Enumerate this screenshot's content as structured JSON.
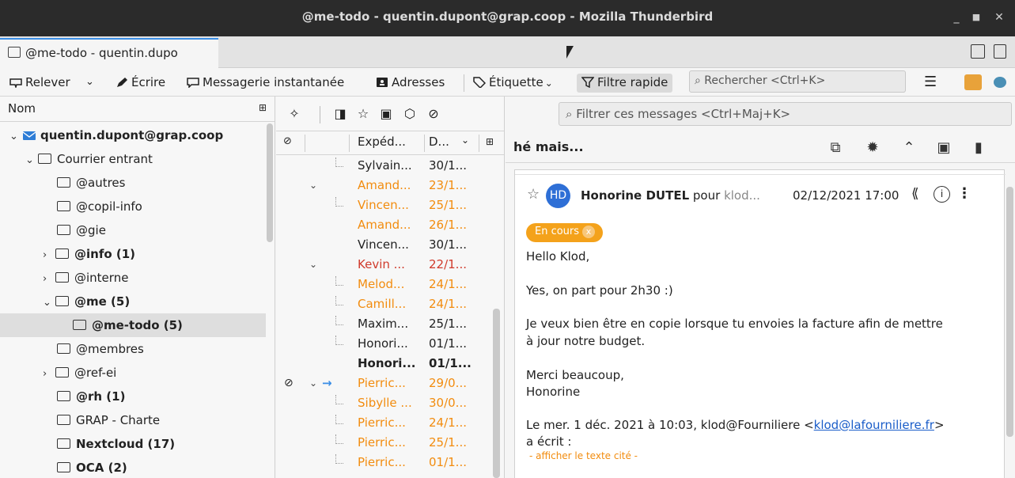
{
  "window": {
    "title": "@me-todo - quentin.dupont@grap.coop - Mozilla Thunderbird",
    "minimize": "_",
    "maximize": "■",
    "close": "✕"
  },
  "tabs": [
    {
      "label": "@me-todo - quentin.dupo"
    }
  ],
  "toolbar": {
    "relever": "Relever",
    "ecrire": "Écrire",
    "messagerie": "Messagerie instantanée",
    "adresses": "Adresses",
    "etiquette": "Étiquette",
    "filtre": "Filtre rapide",
    "search_placeholder": "Rechercher <Ctrl+K>"
  },
  "folders": {
    "header": "Nom",
    "items": [
      {
        "label": "quentin.dupont@grap.coop",
        "bold": true
      },
      {
        "label": "Courrier entrant"
      },
      {
        "label": "@autres"
      },
      {
        "label": "@copil-info"
      },
      {
        "label": "@gie"
      },
      {
        "label": "@info (1)",
        "bold": true
      },
      {
        "label": "@interne"
      },
      {
        "label": "@me (5)",
        "bold": true
      },
      {
        "label": "@me-todo (5)",
        "bold": true,
        "selected": true
      },
      {
        "label": "@membres"
      },
      {
        "label": "@ref-ei"
      },
      {
        "label": "@rh (1)",
        "bold": true
      },
      {
        "label": "GRAP - Charte"
      },
      {
        "label": "Nextcloud (17)",
        "bold": true
      },
      {
        "label": "OCA (2)",
        "bold": true
      }
    ]
  },
  "messagelist": {
    "col_from": "Expéd...",
    "col_date": "D...",
    "filter_placeholder": "Filtrer ces messages <Ctrl+Maj+K>",
    "rows": [
      {
        "from": "Sylvain...",
        "date": "30/1..."
      },
      {
        "from": "Amand...",
        "date": "23/1..."
      },
      {
        "from": "Vincen...",
        "date": "25/1..."
      },
      {
        "from": "Amand...",
        "date": "26/1..."
      },
      {
        "from": "Vincen...",
        "date": "30/1..."
      },
      {
        "from": "Kevin ...",
        "date": "22/1..."
      },
      {
        "from": "Melod...",
        "date": "24/1..."
      },
      {
        "from": "Camill...",
        "date": "24/1..."
      },
      {
        "from": "Maxim...",
        "date": "25/1..."
      },
      {
        "from": "Honori...",
        "date": "01/1..."
      },
      {
        "from": "Honori...",
        "date": "01/1..."
      },
      {
        "from": "Pierric...",
        "date": "29/0..."
      },
      {
        "from": "Sibylle ...",
        "date": "30/0..."
      },
      {
        "from": "Pierric...",
        "date": "24/1..."
      },
      {
        "from": "Pierric...",
        "date": "25/1..."
      },
      {
        "from": "Pierric...",
        "date": "01/1..."
      }
    ]
  },
  "reader": {
    "subject": "hé mais...",
    "avatar_initials": "HD",
    "sender_name": "Honorine DUTEL",
    "sender_for": "pour",
    "sender_recipient": "klod...",
    "date": "02/12/2021 17:00",
    "tag": "En cours",
    "tag_close": "x",
    "body": {
      "l1": "Hello Klod,",
      "l2": "Yes, on part pour 2h30 :)",
      "l3": "Je veux bien être en copie lorsque tu envoies la facture afin de mettre",
      "l4": "à jour notre budget.",
      "l5": "Merci beaucoup,",
      "l6": "Honorine",
      "l7_pre": "Le mer. 1 déc. 2021 à 10:03, klod@Fourniliere <",
      "l7_link": "klod@lafourniliere.fr",
      "l7_post": ">",
      "l8": "a écrit :",
      "show_quote": "- afficher le texte cité -"
    }
  },
  "colors": {
    "accent": "#3a8ee6",
    "orange": "#f28c0f",
    "red": "#d03a2b",
    "tag": "#f4a21b",
    "avatar": "#2e6fd6"
  }
}
